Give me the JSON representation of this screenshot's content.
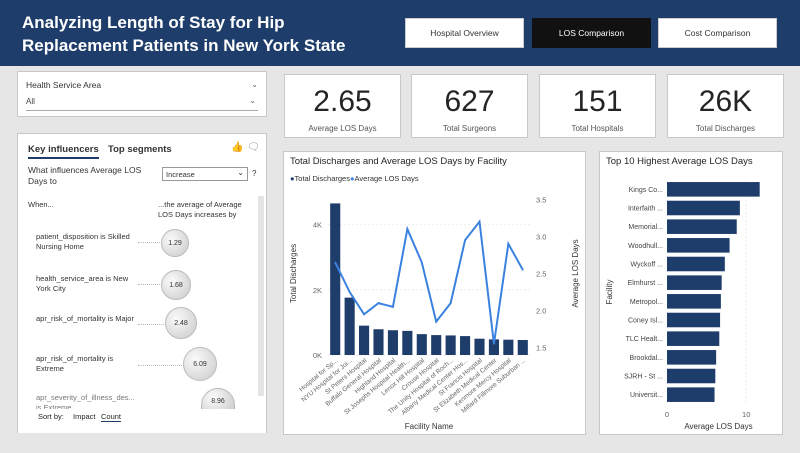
{
  "header": {
    "title_line1": "Analyzing Length of Stay for Hip",
    "title_line2": "Replacement Patients in New York State",
    "nav": [
      {
        "label": "Hospital Overview",
        "active": false
      },
      {
        "label": "LOS Comparison",
        "active": true
      },
      {
        "label": "Cost Comparison",
        "active": false
      }
    ]
  },
  "slicer": {
    "label": "Health Service Area",
    "value": "All"
  },
  "kpis": [
    {
      "value": "2.65",
      "label": "Average LOS Days"
    },
    {
      "value": "627",
      "label": "Total Surgeons"
    },
    {
      "value": "151",
      "label": "Total Hospitals"
    },
    {
      "value": "26K",
      "label": "Total Discharges"
    }
  ],
  "key_influencers": {
    "tab1": "Key influencers",
    "tab2": "Top segments",
    "question": "What influences Average LOS Days to",
    "dropdown": "Increase",
    "help": "?",
    "col_when": "When...",
    "col_effect": "...the average of Average LOS Days increases by",
    "items": [
      {
        "text": "patient_disposition is Skilled Nursing Home",
        "value": "1.29"
      },
      {
        "text": "health_service_area is New York City",
        "value": "1.68"
      },
      {
        "text": "apr_risk_of_mortality is Major",
        "value": "2.48"
      },
      {
        "text": "apr_risk_of_mortality is Extreme",
        "value": "6.09"
      },
      {
        "text": "apr_severity_of_illness_des... is Extreme",
        "value": "8.96"
      }
    ],
    "sort_label": "Sort by:",
    "sort_impact": "Impact",
    "sort_count": "Count"
  },
  "combo_chart": {
    "title": "Total Discharges and Average LOS Days by Facility",
    "legend_discharges": "Total Discharges",
    "legend_los": "Average LOS Days",
    "xlabel": "Facility Name",
    "ylabel_left": "Total Discharges",
    "ylabel_right": "Average LOS Days",
    "colors": {
      "bar": "#1e3d6b",
      "line": "#3b82e0"
    }
  },
  "hbar_chart": {
    "title": "Top 10 Highest Average LOS Days",
    "xlabel": "Average LOS Days",
    "ylabel": "Facility",
    "color": "#1e3d6b"
  },
  "chart_data": [
    {
      "type": "bar",
      "title": "Total Discharges and Average LOS Days by Facility",
      "categories": [
        "Hospital for Sp...",
        "NYU Hospital for Joi...",
        "St Peters Hospital",
        "Buffalo General Hospital",
        "Highland Hospital",
        "St Josephs Hospital Health...",
        "Lenox Hill Hospital",
        "Crouse Hospital",
        "The Unity Hospital of Roch...",
        "Albany Medical Center Hos...",
        "St Francis Hospital",
        "St Elizabeth Medical Center",
        "Kenmore Mercy Hospital",
        "Millard Fillmore Suburban ..."
      ],
      "series": [
        {
          "name": "Total Discharges",
          "axis": "left",
          "values": [
            4650,
            1760,
            900,
            790,
            760,
            740,
            640,
            610,
            600,
            580,
            500,
            480,
            470,
            460
          ]
        },
        {
          "name": "Average LOS Days",
          "type": "line",
          "axis": "right",
          "values": [
            2.65,
            2.25,
            1.95,
            2.1,
            2.05,
            3.1,
            2.65,
            1.85,
            2.1,
            2.95,
            3.2,
            1.55,
            2.9,
            2.55
          ]
        }
      ],
      "xlabel": "Facility Name",
      "ylabel": "Total Discharges",
      "ylabel_right": "Average LOS Days",
      "ylim": [
        0,
        5000
      ],
      "y_ticks": [
        "0K",
        "2K",
        "4K"
      ],
      "y2lim": [
        1.4,
        3.6
      ],
      "y2_ticks": [
        "1.5",
        "2.0",
        "2.5",
        "3.0",
        "3.5"
      ],
      "legend": "top-left"
    },
    {
      "type": "bar",
      "orientation": "horizontal",
      "title": "Top 10 Highest Average LOS Days",
      "categories": [
        "Kings Co...",
        "Interfaith ...",
        "Memorial...",
        "Woodhull...",
        "Wyckoff ...",
        "Elmhurst ...",
        "Metropol...",
        "Coney Isl...",
        "TLC Healt...",
        "Brookdal...",
        "SJRH - St ...",
        "Universit..."
      ],
      "values": [
        11.7,
        9.2,
        8.8,
        7.9,
        7.3,
        6.9,
        6.8,
        6.7,
        6.6,
        6.2,
        6.1,
        6.0
      ],
      "xlabel": "Average LOS Days",
      "ylabel": "Facility",
      "xlim": [
        0,
        13
      ],
      "x_ticks": [
        "0",
        "10"
      ]
    }
  ]
}
